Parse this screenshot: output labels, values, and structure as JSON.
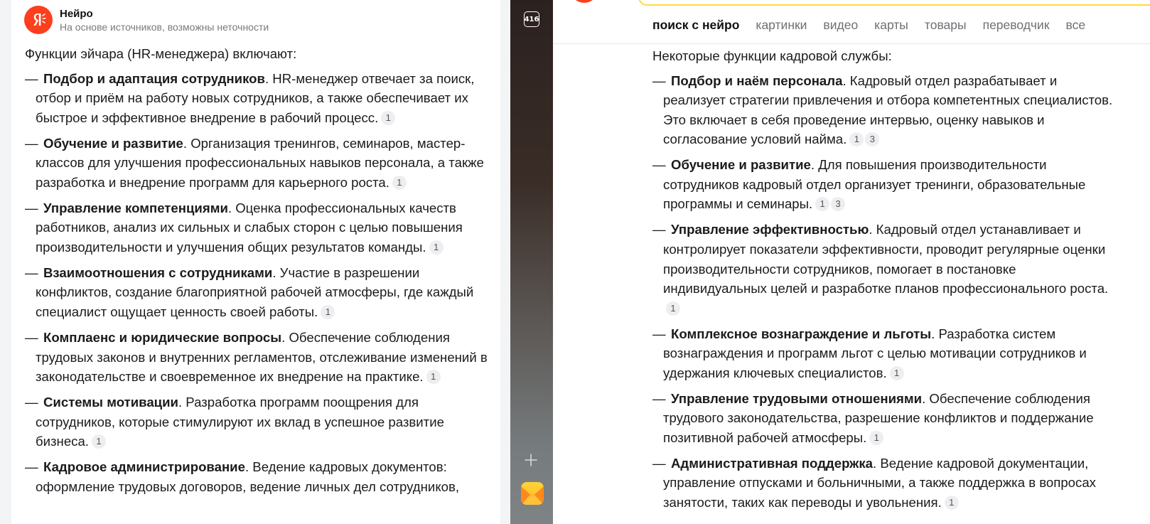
{
  "left": {
    "header": {
      "title": "Нейро",
      "subtitle": "На основе источников, возможны неточности"
    },
    "intro": "Функции эйчара (HR-менеджера) включают:",
    "items": [
      {
        "bold": "Подбор и адаптация сотрудников",
        "text": ". HR-менеджер отвечает за поиск, отбор и приём на работу новых сотрудников, а также обеспечивает их быстрое и эффективное внедрение в рабочий процесс.",
        "refs": [
          "1"
        ]
      },
      {
        "bold": "Обучение и развитие",
        "text": ". Организация тренингов, семинаров, мастер-классов для улучшения профессиональных навыков персонала, а также разработка и внедрение программ для карьерного роста.",
        "refs": [
          "1"
        ]
      },
      {
        "bold": "Управление компетенциями",
        "text": ". Оценка профессиональных качеств работников, анализ их сильных и слабых сторон с целью повышения производительности и улучшения общих результатов команды.",
        "refs": [
          "1"
        ]
      },
      {
        "bold": "Взаимоотношения с сотрудниками",
        "text": ". Участие в разрешении конфликтов, создание благоприятной рабочей атмосферы, где каждый специалист ощущает ценность своей работы.",
        "refs": [
          "1"
        ]
      },
      {
        "bold": "Комплаенс и юридические вопросы",
        "text": ". Обеспечение соблюдения трудовых законов и внутренних регламентов, отслеживание изменений в законодательстве и своевременное их внедрение на практике.",
        "refs": [
          "1"
        ]
      },
      {
        "bold": "Системы мотивации",
        "text": ". Разработка программ поощрения для сотрудников, которые стимулируют их вклад в успешное развитие бизнеса.",
        "refs": [
          "1"
        ]
      },
      {
        "bold": "Кадровое администрирование",
        "text": ". Ведение кадровых документов: оформление трудовых договоров, ведение личных дел сотрудников,",
        "refs": []
      }
    ]
  },
  "strip": {
    "counter": "416"
  },
  "right": {
    "tabs": [
      "поиск с нейро",
      "картинки",
      "видео",
      "карты",
      "товары",
      "переводчик",
      "все"
    ],
    "intro": "Некоторые функции кадровой службы:",
    "items": [
      {
        "bold": "Подбор и наём персонала",
        "text": ". Кадровый отдел разрабатывает и реализует стратегии привлечения и отбора компетентных специалистов. Это включает в себя проведение интервью, оценку навыков и согласование условий найма.",
        "refs": [
          "1",
          "3"
        ]
      },
      {
        "bold": "Обучение и развитие",
        "text": ". Для повышения производительности сотрудников кадровый отдел организует тренинги, образовательные программы и семинары.",
        "refs": [
          "1",
          "3"
        ]
      },
      {
        "bold": "Управление эффективностью",
        "text": ". Кадровый отдел устанавливает и контролирует показатели эффективности, проводит регулярные оценки производительности сотрудников, помогает в постановке индивидуальных целей и разработке планов профессионального роста.",
        "refs": [
          "1"
        ]
      },
      {
        "bold": "Комплексное вознаграждение и льготы",
        "text": ". Разработка систем вознаграждения и программ льгот с целью мотивации сотрудников и удержания ключевых специалистов.",
        "refs": [
          "1"
        ]
      },
      {
        "bold": "Управление трудовыми отношениями",
        "text": ". Обеспечение соблюдения трудового законодательства, разрешение конфликтов и поддержание позитивной рабочей атмосферы.",
        "refs": [
          "1"
        ]
      },
      {
        "bold": "Административная поддержка",
        "text": ". Ведение кадровой документации, управление отпусками и больничными, а также поддержка в вопросах занятости, таких как переводы и увольнения.",
        "refs": [
          "1"
        ]
      }
    ]
  },
  "icons": {
    "logo": "yandex-neuro-logo-icon",
    "plus": "plus-icon",
    "mail": "mail-icon"
  },
  "colors": {
    "brand_red": "#fc3f1d",
    "search_yellow": "#ffd93a",
    "ref_bg": "#eeeef0"
  }
}
